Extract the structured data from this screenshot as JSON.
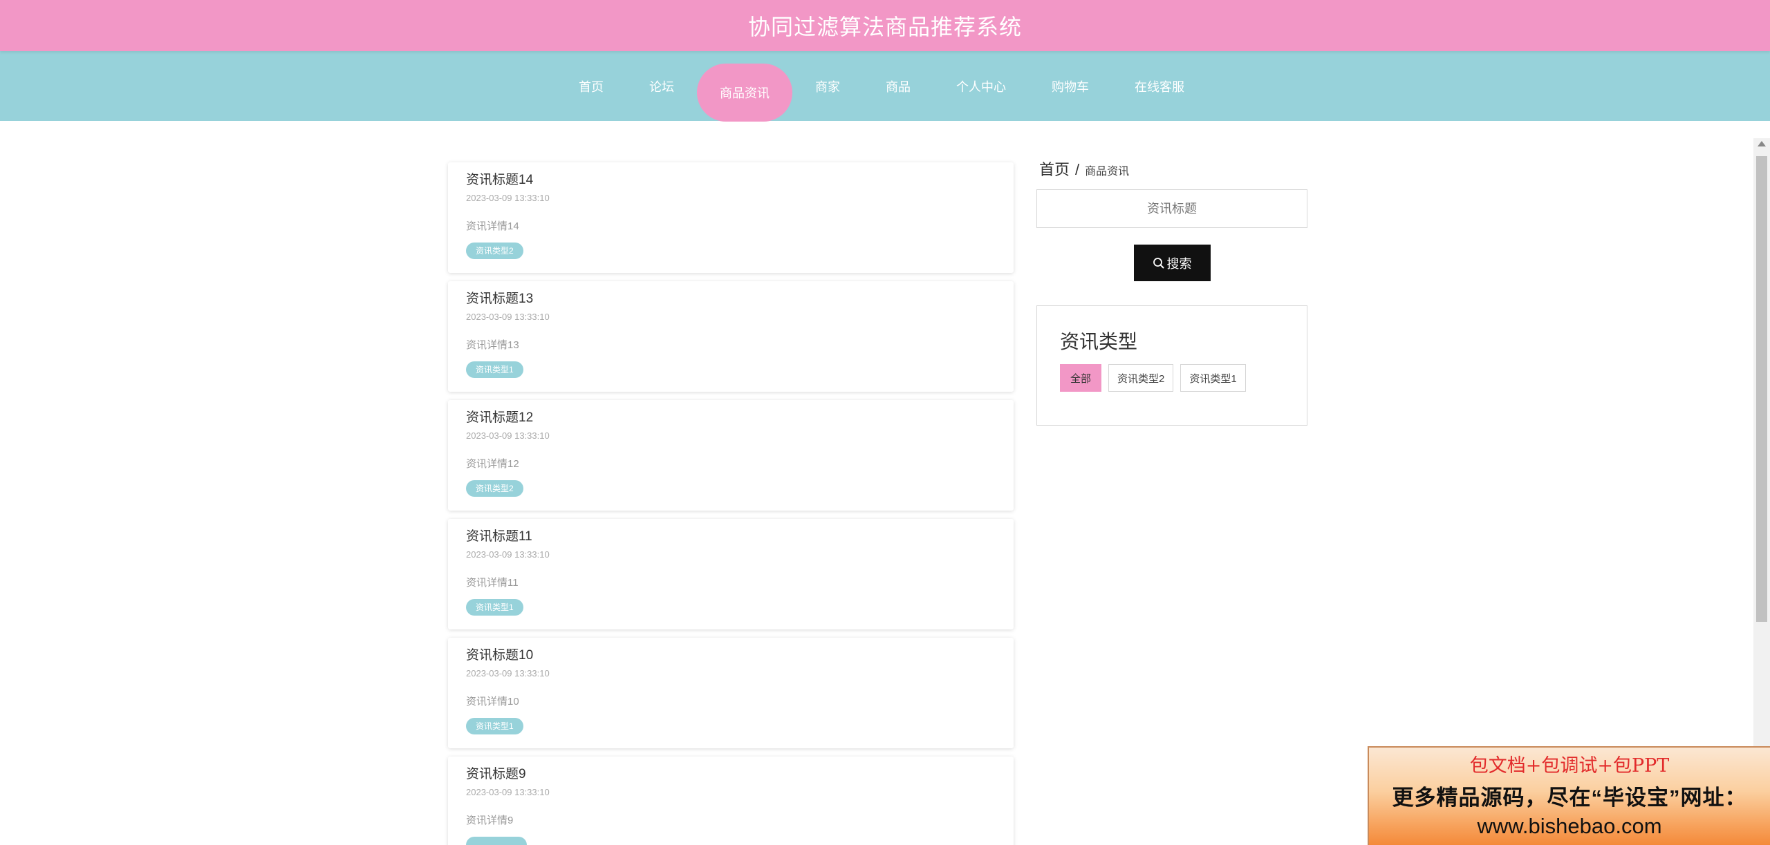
{
  "header": {
    "title": "协同过滤算法商品推荐系统"
  },
  "nav": {
    "items": [
      {
        "label": "首页",
        "active": false
      },
      {
        "label": "论坛",
        "active": false
      },
      {
        "label": "商品资讯",
        "active": true
      },
      {
        "label": "商家",
        "active": false
      },
      {
        "label": "商品",
        "active": false
      },
      {
        "label": "个人中心",
        "active": false
      },
      {
        "label": "购物车",
        "active": false
      },
      {
        "label": "在线客服",
        "active": false
      }
    ]
  },
  "news": [
    {
      "title": "资讯标题14",
      "time": "2023-03-09 13:33:10",
      "desc": "资讯详情14",
      "tag": "资讯类型2"
    },
    {
      "title": "资讯标题13",
      "time": "2023-03-09 13:33:10",
      "desc": "资讯详情13",
      "tag": "资讯类型1"
    },
    {
      "title": "资讯标题12",
      "time": "2023-03-09 13:33:10",
      "desc": "资讯详情12",
      "tag": "资讯类型2"
    },
    {
      "title": "资讯标题11",
      "time": "2023-03-09 13:33:10",
      "desc": "资讯详情11",
      "tag": "资讯类型1"
    },
    {
      "title": "资讯标题10",
      "time": "2023-03-09 13:33:10",
      "desc": "资讯详情10",
      "tag": "资讯类型1"
    },
    {
      "title": "资讯标题9",
      "time": "2023-03-09 13:33:10",
      "desc": "资讯详情9",
      "tag": ""
    }
  ],
  "breadcrumb": {
    "home": "首页",
    "separator": "/",
    "current": "商品资讯"
  },
  "search": {
    "placeholder": "资讯标题",
    "value": "",
    "button_label": "搜索",
    "button_icon": "search-icon"
  },
  "types": {
    "heading": "资讯类型",
    "items": [
      {
        "label": "全部",
        "active": true
      },
      {
        "label": "资讯类型2",
        "active": false
      },
      {
        "label": "资讯类型1",
        "active": false
      }
    ]
  },
  "ad": {
    "line1": "包文档+包调试+包PPT",
    "line2": "更多精品源码，尽在“毕设宝”网址：",
    "line3": "www.bishebao.com"
  },
  "colors": {
    "pink": "#f297c6",
    "teal": "#97d2da",
    "dark": "#111111"
  }
}
